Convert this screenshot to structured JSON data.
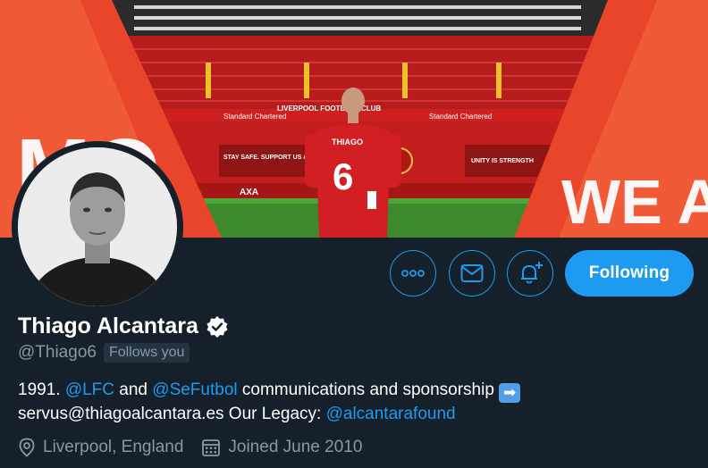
{
  "banner": {
    "left_text": "MO",
    "right_text": "WE A",
    "sponsor_board_left": "Standard Chartered",
    "sponsor_board_right": "Standard Chartered",
    "stand_banner": "LIVERPOOL FOOTBALL CLUB",
    "board_stay_safe": "STAY SAFE. SUPPORT US AT HOME.",
    "board_unity": "UNITY IS STRENGTH",
    "board_axa": "AXA",
    "shirt_name": "THIAGO",
    "shirt_number": "6"
  },
  "profile": {
    "display_name": "Thiago Alcantara",
    "handle": "@Thiago6",
    "follows_you": "Follows you",
    "bio": {
      "part1": "1991. ",
      "mention1": "@LFC",
      "part2": " and ",
      "mention2": "@SeFutbol",
      "part3": " communications and sponsorship ",
      "emoji": "➡",
      "line2_text": "servus@thiagoalcantara.es Our Legacy: ",
      "mention3": "@alcantarafound"
    },
    "location": "Liverpool, England",
    "joined": "Joined June 2010"
  },
  "actions": {
    "follow_label": "Following"
  },
  "icons": {
    "more": "more-icon",
    "message": "mail-icon",
    "notify": "bell-plus-icon",
    "verified": "verified-badge-icon",
    "location": "location-pin-icon",
    "calendar": "calendar-icon"
  },
  "colors": {
    "background": "#15202b",
    "accent": "#1d9bf0",
    "secondary_text": "#8899a6"
  }
}
